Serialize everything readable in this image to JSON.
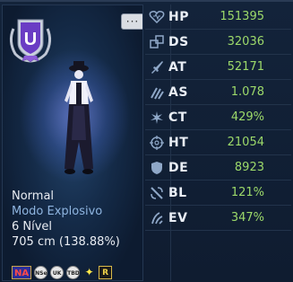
{
  "header": {
    "chat_icon_glyph": "···"
  },
  "rank_badge": {
    "icon": "u-rank-shield-icon",
    "letter": "U"
  },
  "character_info": {
    "status": "Normal",
    "mode": "Modo Explosivo",
    "level": "6 Nível",
    "height": "705 cm (138.88%)"
  },
  "badges": [
    {
      "name": "na-badge",
      "text": "NA"
    },
    {
      "name": "nse-badge",
      "text": "NSe"
    },
    {
      "name": "uk-badge",
      "text": "UK"
    },
    {
      "name": "tbd-badge",
      "text": "TBD"
    },
    {
      "name": "star-badge",
      "text": "✦"
    },
    {
      "name": "r-badge",
      "text": "R"
    }
  ],
  "stats": [
    {
      "abbr": "HP",
      "value": "151395",
      "icon": "heart-icon"
    },
    {
      "abbr": "DS",
      "value": "32036",
      "icon": "squares-icon"
    },
    {
      "abbr": "AT",
      "value": "52171",
      "icon": "sword-icon"
    },
    {
      "abbr": "AS",
      "value": "1.078",
      "icon": "claw-icon"
    },
    {
      "abbr": "CT",
      "value": "429%",
      "icon": "critical-burst-icon"
    },
    {
      "abbr": "HT",
      "value": "21054",
      "icon": "crosshair-icon"
    },
    {
      "abbr": "DE",
      "value": "8923",
      "icon": "shield-icon"
    },
    {
      "abbr": "BL",
      "value": "121%",
      "icon": "block-icon"
    },
    {
      "abbr": "EV",
      "value": "347%",
      "icon": "evade-icon"
    }
  ],
  "colors": {
    "stat_value": "#9cd96a",
    "stat_label": "#e9eef5",
    "panel_bg": "#0f1c30"
  }
}
